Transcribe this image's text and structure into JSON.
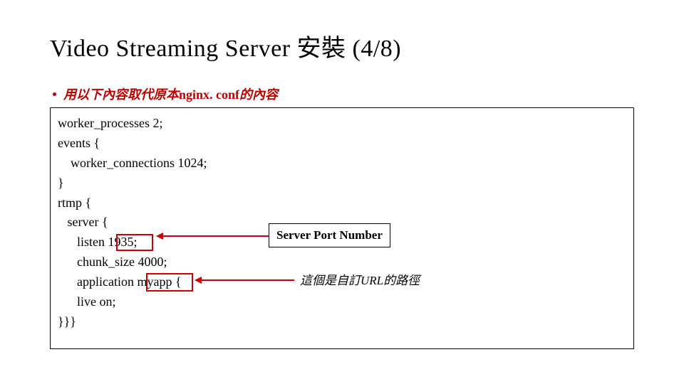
{
  "title": "Video Streaming Server 安裝 (4/8)",
  "bullet": {
    "prefix": "用以下內容取代原本",
    "latin": "nginx. conf",
    "suffix": "的內容"
  },
  "code": {
    "l1": "worker_processes 2;",
    "l2": "events {",
    "l3": "    worker_connections 1024;",
    "l4": "}",
    "l5": "rtmp {",
    "l6": "   server {",
    "l7": "      listen 1935;",
    "l8": "      chunk_size 4000;",
    "l9": "      application myapp {",
    "l10": "      live on;",
    "l11": "}}}"
  },
  "callouts": {
    "port": "Server Port Number",
    "url": "這個是自訂URL的路徑"
  }
}
